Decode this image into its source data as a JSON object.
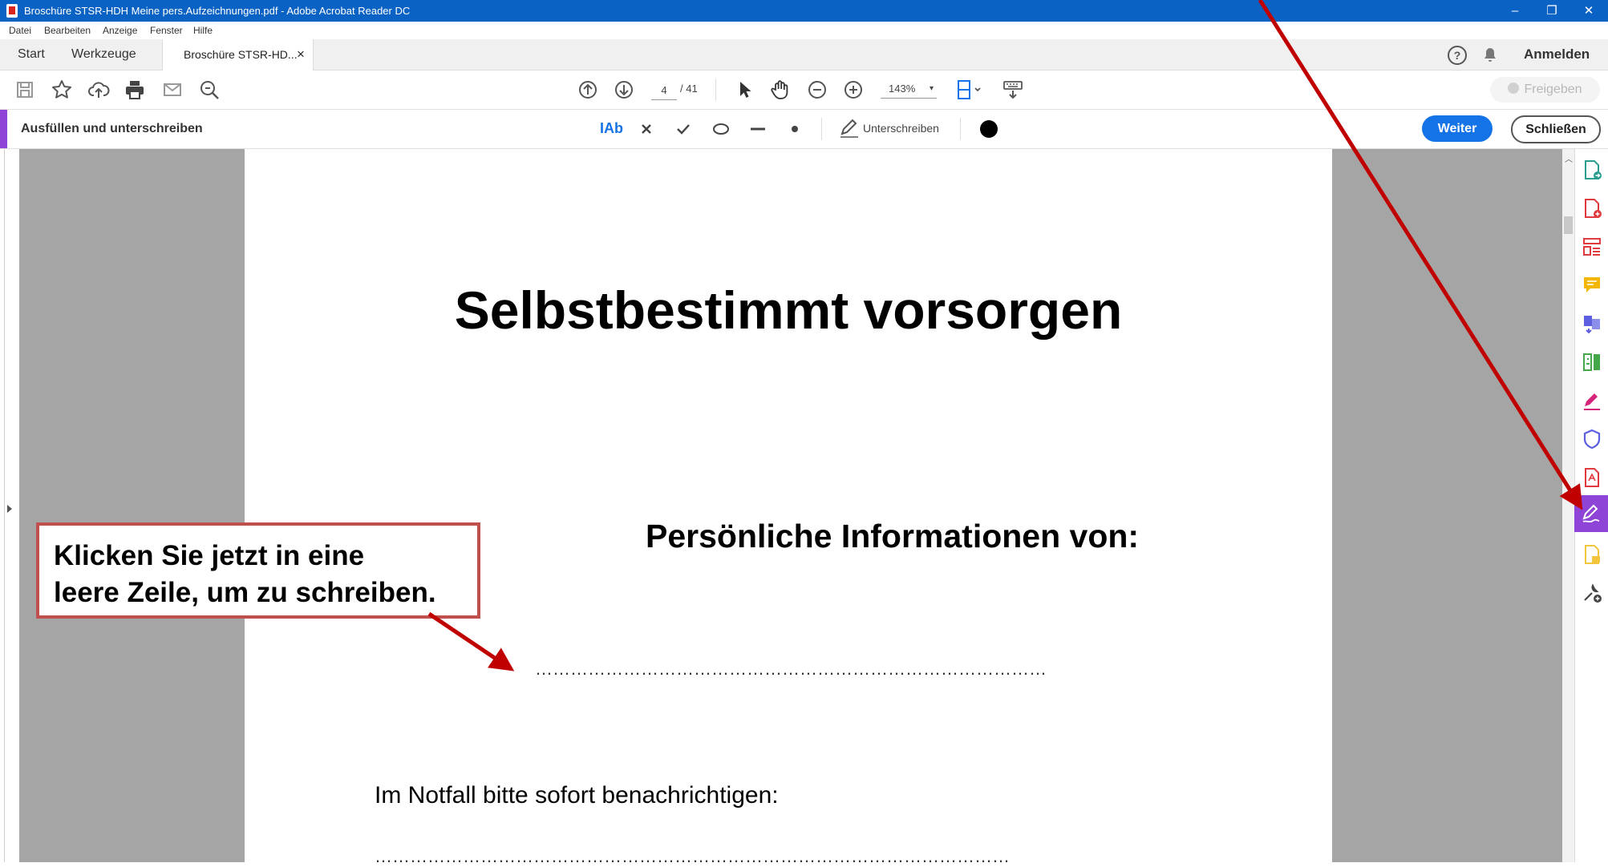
{
  "window": {
    "title": "Broschüre STSR-HDH Meine pers.Aufzeichnungen.pdf - Adobe Acrobat Reader DC",
    "controls": [
      "–",
      "❐",
      "✕"
    ]
  },
  "menu": [
    "Datei",
    "Bearbeiten",
    "Anzeige",
    "Fenster",
    "Hilfe"
  ],
  "tabs": {
    "start": "Start",
    "tools": "Werkzeuge",
    "document": "Broschüre STSR-HD...",
    "close_glyph": "×"
  },
  "account": {
    "help_glyph": "?",
    "signin": "Anmelden"
  },
  "toolbar": {
    "page_current": "4",
    "page_total": "/ 41",
    "zoom": "143%",
    "zoom_dropdown": "▾",
    "share": "Freigeben"
  },
  "fillsign": {
    "title": "Ausfüllen und unterschreiben",
    "text_tool": "IAb",
    "sign": "Unterschreiben",
    "next": "Weiter",
    "close": "Schließen",
    "color": "#000000"
  },
  "document": {
    "title": "Selbstbestimmt vorsorgen",
    "subtitle": "Persönliche Informationen von:",
    "line1": "……………………………………………………………………………",
    "emergency_label": "Im Notfall bitte sofort benachrichtigen:",
    "line2": "………………………………………………………………………………………………"
  },
  "callout": {
    "line1": "Klicken Sie jetzt in eine",
    "line2": "leere Zeile, um zu schreiben."
  },
  "annotation_color": "#c00000",
  "accent_color": "#8e44d6",
  "right_panel_icons": [
    "export-pdf-icon",
    "create-pdf-icon",
    "organize-pages-icon",
    "comment-icon",
    "combine-files-icon",
    "edit-pdf-icon",
    "request-signatures-icon",
    "protect-icon",
    "compress-pdf-icon",
    "fill-sign-icon",
    "send-for-review-icon",
    "more-tools-icon"
  ]
}
